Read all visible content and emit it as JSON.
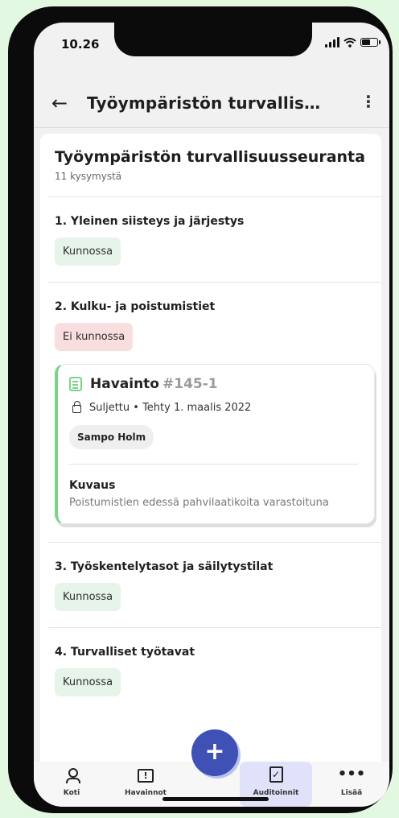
{
  "status_bar": {
    "time": "10.26"
  },
  "app_bar": {
    "title": "Työympäristön turvallis…"
  },
  "audit": {
    "title": "Työympäristön turvallisuusseuranta",
    "subtitle": "11 kysymystä"
  },
  "questions": [
    {
      "title": "1. Yleinen siisteys ja järjestys",
      "status": "Kunnossa"
    },
    {
      "title": "2. Kulku- ja poistumistiet",
      "status": "Ei kunnossa"
    },
    {
      "title": "3. Työskentelytasot ja säilytystilat",
      "status": "Kunnossa"
    },
    {
      "title": "4. Turvalliset työtavat",
      "status": "Kunnossa"
    }
  ],
  "finding": {
    "title": "Havainto",
    "id": "#145-1",
    "status": "Suljettu • Tehty 1. maalis 2022",
    "person": "Sampo Holm",
    "description_label": "Kuvaus",
    "description": "Poistumistien edessä pahvilaatikoita varastoituna"
  },
  "bottom_nav": {
    "items": [
      {
        "label": "Koti",
        "icon": "person-icon"
      },
      {
        "label": "Havainnot",
        "icon": "report-icon"
      },
      {
        "label": "Auditoinnit",
        "icon": "clipboard-check-icon",
        "active": true
      },
      {
        "label": "Lisää",
        "icon": "more-horizontal-icon"
      }
    ],
    "fab_label": "+"
  },
  "colors": {
    "accent": "#3f51b5",
    "ok_bg": "#e6f4ea",
    "bad_bg": "#f8dede",
    "finding_accent": "#7bd389"
  }
}
